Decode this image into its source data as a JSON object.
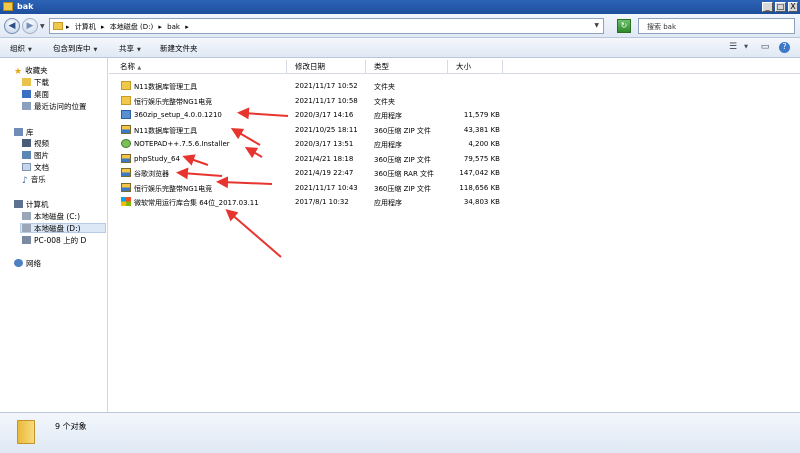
{
  "window": {
    "title": "bak",
    "min": "_",
    "max": "□",
    "close": "X"
  },
  "address": {
    "crumbs": [
      "▸",
      "计算机",
      "▸",
      "本地磁盘 (D:)",
      "▸",
      "bak",
      "▸"
    ],
    "search_placeholder": "搜索 bak"
  },
  "toolbar": {
    "organize": "组织",
    "include_in_library": "包含到库中",
    "share": "共享",
    "new_folder": "新建文件夹"
  },
  "nav": {
    "favorites": "收藏夹",
    "downloads": "下载",
    "desktop": "桌面",
    "recent": "最近访问的位置",
    "libraries": "库",
    "videos": "视频",
    "pictures": "图片",
    "documents": "文档",
    "music": "音乐",
    "computer": "计算机",
    "drive_c": "本地磁盘 (C:)",
    "drive_d": "本地磁盘 (D:)",
    "network_drive": "PC-008 上的 D",
    "network": "网络"
  },
  "columns": {
    "name": "名称",
    "date": "修改日期",
    "type": "类型",
    "size": "大小"
  },
  "files": [
    {
      "name": "N11数据库管理工具",
      "date": "2021/11/17 10:52",
      "type": "文件夹",
      "size": "",
      "icon": "folder"
    },
    {
      "name": "恒行娱乐完整带NG1电竞",
      "date": "2021/11/17 10:58",
      "type": "文件夹",
      "size": "",
      "icon": "folder"
    },
    {
      "name": "360zip_setup_4.0.0.1210",
      "date": "2020/3/17 14:16",
      "type": "应用程序",
      "size": "11,579 KB",
      "icon": "exe"
    },
    {
      "name": "N11数据库管理工具",
      "date": "2021/10/25 18:11",
      "type": "360压缩 ZIP 文件",
      "size": "43,381 KB",
      "icon": "zip"
    },
    {
      "name": "NOTEPAD++.7.5.6.Installer",
      "date": "2020/3/17 13:51",
      "type": "应用程序",
      "size": "4,200 KB",
      "icon": "npp"
    },
    {
      "name": "phpStudy_64",
      "date": "2021/4/21 18:18",
      "type": "360压缩 ZIP 文件",
      "size": "79,575 KB",
      "icon": "zip"
    },
    {
      "name": "谷歌浏览器",
      "date": "2021/4/19 22:47",
      "type": "360压缩 RAR 文件",
      "size": "147,042 KB",
      "icon": "zip"
    },
    {
      "name": "恒行娱乐完整带NG1电竞",
      "date": "2021/11/17 10:43",
      "type": "360压缩 ZIP 文件",
      "size": "118,656 KB",
      "icon": "zip"
    },
    {
      "name": "微软常用运行库合集 64位_2017.03.11",
      "date": "2017/8/1 10:32",
      "type": "应用程序",
      "size": "34,803 KB",
      "icon": "win"
    }
  ],
  "status": {
    "count_text": "9 个对象"
  },
  "colors": {
    "accent": "#2d63b5",
    "annotation_arrow": "#e8342e"
  }
}
